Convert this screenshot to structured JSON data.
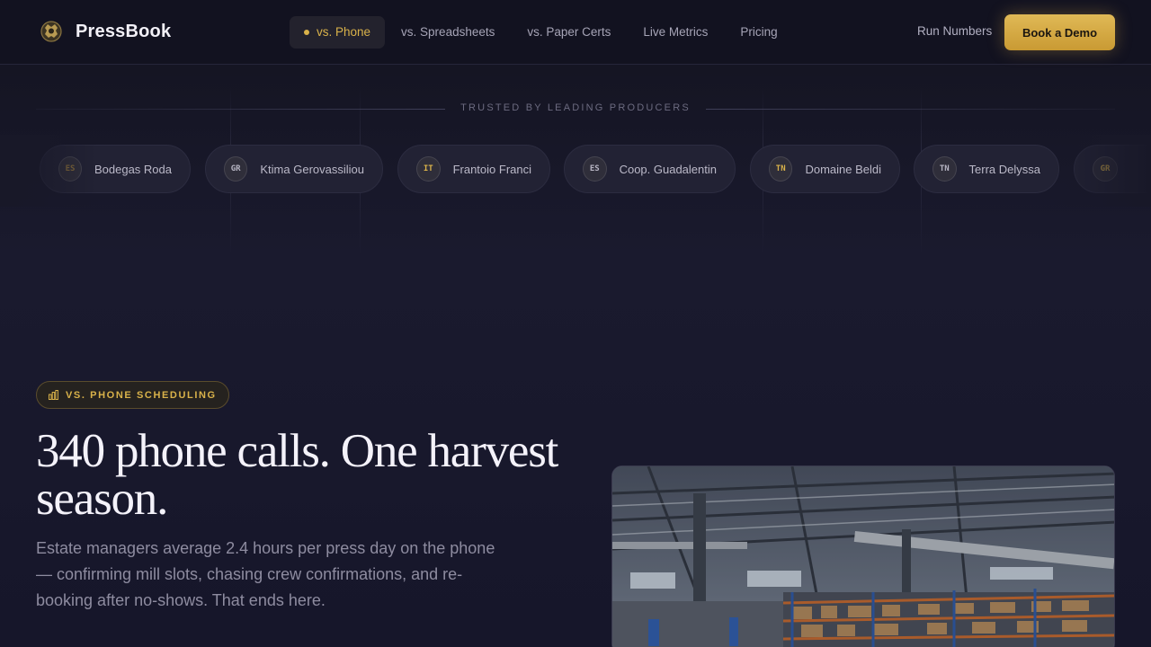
{
  "brand": {
    "name": "PressBook",
    "icon": "gear-crest-icon"
  },
  "nav": {
    "links": [
      {
        "label": "vs. Phone",
        "active": true
      },
      {
        "label": "vs. Spreadsheets",
        "active": false
      },
      {
        "label": "vs. Paper Certs",
        "active": false
      },
      {
        "label": "Live Metrics",
        "active": false
      },
      {
        "label": "Pricing",
        "active": false
      }
    ],
    "run_numbers": "Run Numbers",
    "cta": "Book a Demo"
  },
  "trusted": {
    "heading": "TRUSTED BY LEADING PRODUCERS",
    "producers": [
      {
        "code": "ES",
        "name": "Bodegas Roda",
        "badge_color": "#8a6f3a"
      },
      {
        "code": "GR",
        "name": "Ktima Gerovassiliou",
        "badge_color": "#b8b6c4"
      },
      {
        "code": "IT",
        "name": "Frantoio Franci",
        "badge_color": "#d9b24a"
      },
      {
        "code": "ES",
        "name": "Coop. Guadalentin",
        "badge_color": "#b8b6c4"
      },
      {
        "code": "TN",
        "name": "Domaine Beldi",
        "badge_color": "#d9b24a"
      },
      {
        "code": "TN",
        "name": "Terra Delyssa",
        "badge_color": "#b8b6c4"
      },
      {
        "code": "GR",
        "name": "",
        "badge_color": "#d9b24a"
      }
    ]
  },
  "hero": {
    "eyebrow": "VS. PHONE SCHEDULING",
    "eyebrow_icon": "bar-chart-icon",
    "headline": "340 phone calls. One harvest season.",
    "subtext": "Estate managers average 2.4 hours per press day on the phone — confirming mill slots, chasing crew confirmations, and re-booking after no-shows. That ends here.",
    "image": "warehouse-photo"
  },
  "colors": {
    "accent": "#d9b24a",
    "background": "#17172a"
  }
}
